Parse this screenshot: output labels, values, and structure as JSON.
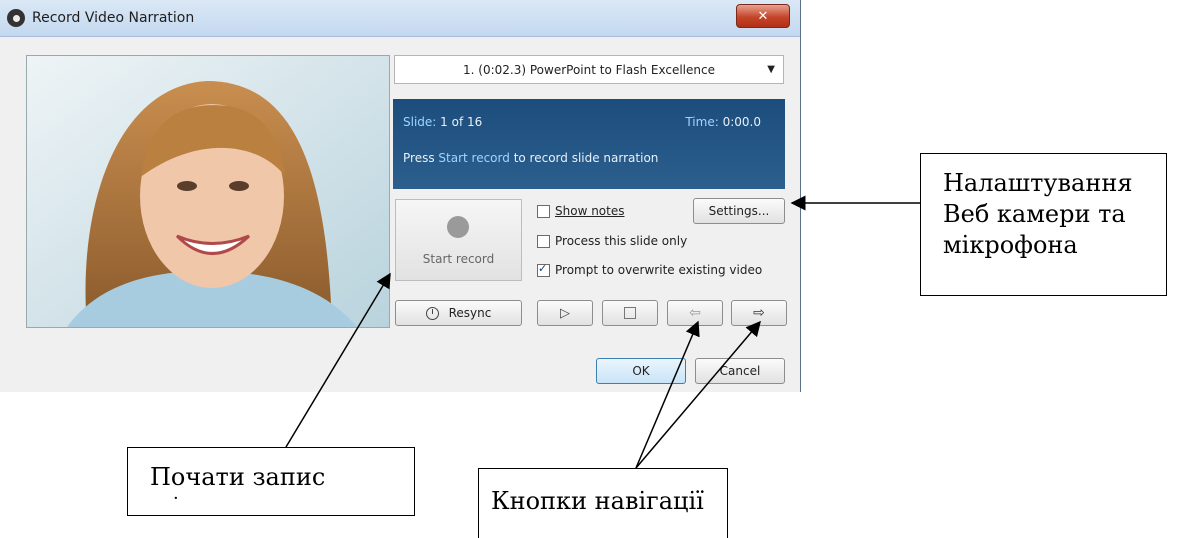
{
  "window": {
    "title": "Record Video Narration",
    "close_glyph": "✕",
    "app_icon": "webcam-icon"
  },
  "slide_selector": {
    "value": "1. (0:02.3) PowerPoint to Flash Excellence"
  },
  "info_panel": {
    "slide_label": "Slide:",
    "slide_value": "1 of 16",
    "time_label": "Time:",
    "time_value": "0:00.0",
    "message_prefix": "Press ",
    "message_link": "Start record",
    "message_suffix": " to record slide narration"
  },
  "record_button": {
    "label": "Start record"
  },
  "options": {
    "show_notes": {
      "label": "Show notes",
      "checked": false
    },
    "process_slide_only": {
      "label": "Process this slide only",
      "checked": false
    },
    "prompt_overwrite": {
      "label": "Prompt to overwrite existing video",
      "checked": true
    }
  },
  "buttons": {
    "settings": "Settings...",
    "resync": "Resync",
    "ok": "OK",
    "cancel": "Cancel"
  },
  "icons": {
    "resync": "clock-icon",
    "play": "play-icon",
    "stop": "stop-icon",
    "prev": "prev-arrow-icon",
    "next": "next-arrow-icon"
  },
  "annotations": {
    "settings_line1": "Налаштування",
    "settings_line2": "Веб камери та",
    "settings_line3": "мікрофона",
    "record": "Почати запис",
    "record_dot": "·",
    "nav": "Кнопки навігації"
  },
  "colors": {
    "info_panel_bg": "#1c4d7c",
    "info_highlight": "#9ed6ff",
    "close_button": "#c5452a"
  }
}
